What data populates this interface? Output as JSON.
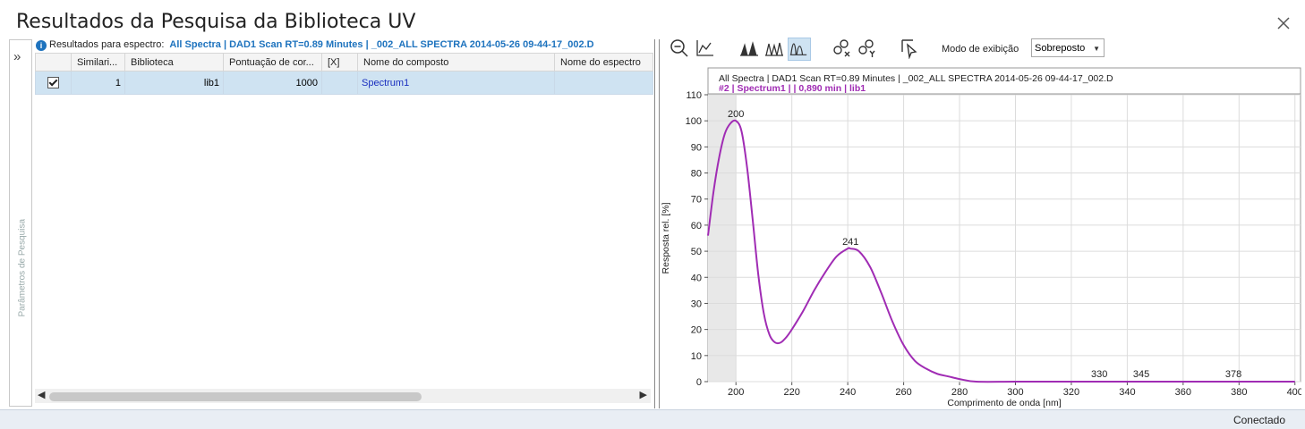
{
  "window": {
    "title": "Resultados da Pesquisa da Biblioteca UV"
  },
  "left_panel": {
    "vertical_label": "Parâmetros de Pesquisa",
    "expand_glyph": "»"
  },
  "results": {
    "header_label": "Resultados para espectro:",
    "header_source": "All Spectra  |  DAD1 Scan RT=0.89 Minutes  |  _002_ALL SPECTRA 2014-05-26 09-44-17_002.D",
    "columns": [
      "",
      "Similari...",
      "Biblioteca",
      "Pontuação de cor...",
      "[X]",
      "Nome do composto",
      "Nome do espectro"
    ],
    "rows": [
      {
        "checked": true,
        "similarity": "1",
        "library": "lib1",
        "score": "1000",
        "x": "",
        "compound": "Spectrum1",
        "spectrum": ""
      }
    ]
  },
  "toolbar": {
    "icons": [
      "zoom-out-icon",
      "autoscale-icon",
      "peaks-view-1-icon",
      "peaks-view-2-icon",
      "peaks-overlay-icon",
      "unlink-x-icon",
      "unlink-y-icon",
      "spectrum-select-icon"
    ],
    "mode_label": "Modo de exibição",
    "mode_value": "Sobreposto"
  },
  "chart_data": {
    "type": "line",
    "header_line1": "All Spectra | DAD1 Scan RT=0.89 Minutes | _002_ALL SPECTRA 2014-05-26 09-44-17_002.D",
    "header_line2": "#2 | Spectrum1 |  | 0,890 min | lib1",
    "xlabel": "Comprimento de onda [nm]",
    "ylabel": "Resposta rel. [%]",
    "xlim": [
      190,
      402
    ],
    "ylim": [
      0,
      110
    ],
    "xticks": [
      200,
      220,
      240,
      260,
      280,
      300,
      320,
      340,
      360,
      380,
      400
    ],
    "yticks": [
      0,
      10,
      20,
      30,
      40,
      50,
      60,
      70,
      80,
      90,
      100,
      110
    ],
    "shaded_region": [
      190,
      200
    ],
    "line_color": "#a02cb4",
    "peak_labels": [
      {
        "label": "200",
        "x": 200,
        "y": 100
      },
      {
        "label": "241",
        "x": 241,
        "y": 51
      },
      {
        "label": "330",
        "x": 330,
        "y": 0.3
      },
      {
        "label": "345",
        "x": 345,
        "y": 0.3
      },
      {
        "label": "378",
        "x": 378,
        "y": 0.3
      }
    ],
    "series": [
      {
        "x": [
          190,
          192,
          194,
          196,
          198,
          200,
          202,
          204,
          206,
          208,
          210,
          212,
          214,
          216,
          218,
          220,
          224,
          228,
          232,
          236,
          240,
          241,
          244,
          248,
          252,
          256,
          260,
          264,
          268,
          272,
          276,
          280,
          286,
          300,
          320,
          340,
          360,
          380,
          400
        ],
        "y": [
          56,
          73,
          86,
          95,
          99,
          100,
          96,
          82,
          62,
          41,
          26,
          18,
          15,
          15,
          17,
          20,
          27,
          35,
          42,
          48,
          51,
          51,
          50,
          44,
          34,
          23,
          14,
          8,
          5,
          3,
          2,
          1,
          0,
          0,
          0,
          0,
          0,
          0,
          0
        ]
      }
    ]
  },
  "status": {
    "text": "Conectado"
  }
}
